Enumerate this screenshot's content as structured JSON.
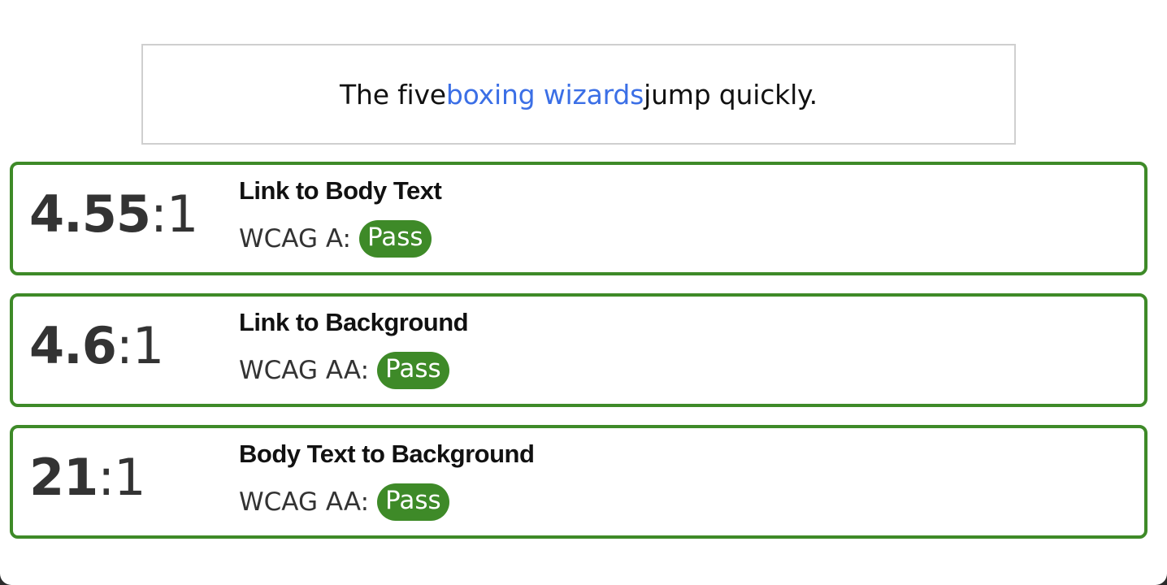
{
  "preview": {
    "before": "The five ",
    "link": "boxing wizards",
    "after": " jump quickly."
  },
  "results": [
    {
      "ratio_main": "4.55",
      "ratio_sep": ":",
      "ratio_end": "1",
      "label": "Link to Body Text",
      "wcag": "WCAG A:",
      "status": "Pass"
    },
    {
      "ratio_main": "4.6",
      "ratio_sep": ":",
      "ratio_end": "1",
      "label": "Link to Background",
      "wcag": "WCAG AA:",
      "status": "Pass"
    },
    {
      "ratio_main": "21",
      "ratio_sep": ":",
      "ratio_end": "1",
      "label": "Body Text to Background",
      "wcag": "WCAG AA:",
      "status": "Pass"
    }
  ],
  "colors": {
    "pass": "#3e8a28",
    "link": "#3b6fe6",
    "border": "#cfcfcf"
  }
}
